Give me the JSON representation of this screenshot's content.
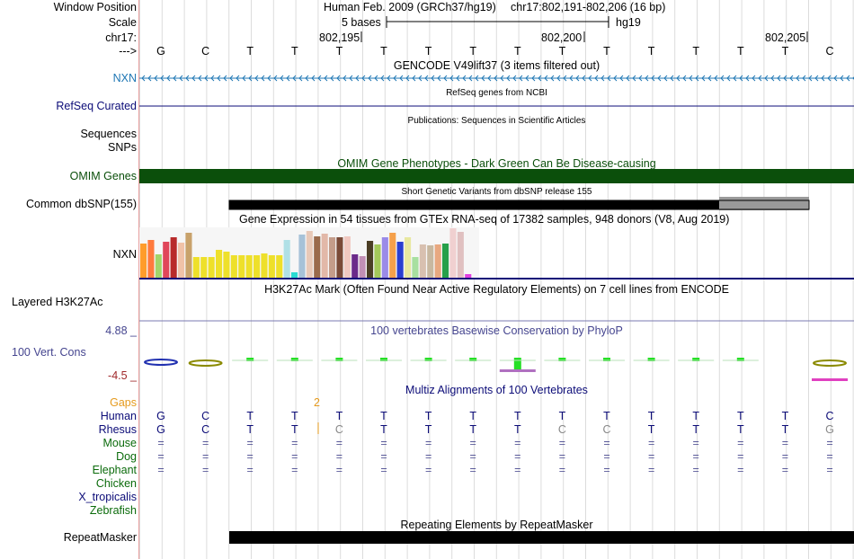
{
  "header": {
    "window_position_label": "Window Position",
    "scale_label": "Scale",
    "chrom_label": "chr17:",
    "strand_label": "--->",
    "assembly": "Human Feb. 2009 (GRCh37/hg19)",
    "position": "chr17:802,191-802,206 (16 bp)",
    "scale_text": "5 bases",
    "scale_db": "hg19",
    "ticks": [
      "802,195",
      "802,200",
      "802,205"
    ]
  },
  "bases": [
    "G",
    "C",
    "T",
    "T",
    "T",
    "T",
    "T",
    "T",
    "T",
    "T",
    "T",
    "T",
    "T",
    "T",
    "T",
    "C"
  ],
  "tracks": {
    "gencode": {
      "title": "GENCODE V49lift37 (3 items filtered out)",
      "label": "NXN"
    },
    "refseq": {
      "title": "RefSeq genes from NCBI",
      "label": "RefSeq Curated"
    },
    "publications": {
      "title": "Publications: Sequences in Scientific Articles",
      "label1": "Sequences",
      "label2": "SNPs"
    },
    "omim": {
      "title": "OMIM Gene Phenotypes - Dark Green Can Be Disease-causing",
      "label": "OMIM Genes"
    },
    "dbsnp": {
      "title": "Short Genetic Variants from dbSNP release 155",
      "label": "Common dbSNP(155)"
    },
    "gtex": {
      "title": "Gene Expression in 54 tissues from GTEx RNA-seq of 17382 samples, 948 donors (V8, Aug 2019)",
      "label": "NXN"
    },
    "h3k27ac": {
      "title": "H3K27Ac Mark (Often Found Near Active Regulatory Elements) on 7 cell lines from ENCODE",
      "label": "Layered H3K27Ac"
    },
    "phylop": {
      "title": "100 vertebrates Basewise Conservation by PhyloP",
      "label": "100 Vert. Cons",
      "max": "4.88 _",
      "min": "-4.5 _"
    },
    "multiz": {
      "title": "Multiz Alignments of 100 Vertebrates",
      "gaps_label": "Gaps",
      "gap_count": "2",
      "species": [
        "Human",
        "Rhesus",
        "Mouse",
        "Dog",
        "Elephant",
        "Chicken",
        "X_tropicalis",
        "Zebrafish"
      ],
      "human_bases": [
        "G",
        "C",
        "T",
        "T",
        "T",
        "T",
        "T",
        "T",
        "T",
        "T",
        "T",
        "T",
        "T",
        "T",
        "T",
        "C"
      ],
      "rhesus_bases": [
        "G",
        "C",
        "T",
        "T",
        "C",
        "T",
        "T",
        "T",
        "T",
        "C",
        "C",
        "T",
        "T",
        "T",
        "T",
        "G"
      ],
      "eq_symbol": "="
    },
    "repeatmasker": {
      "title": "Repeating Elements by RepeatMasker",
      "label": "RepeatMasker"
    }
  },
  "colors": {
    "gene_blue": "#0c0c78",
    "nxn_label": "#1f77b4",
    "omim_green": "#0b4f0b",
    "phylop_label": "#45458f",
    "gaps_orange": "#e59a1d",
    "rhesus_gray": "#888888"
  }
}
